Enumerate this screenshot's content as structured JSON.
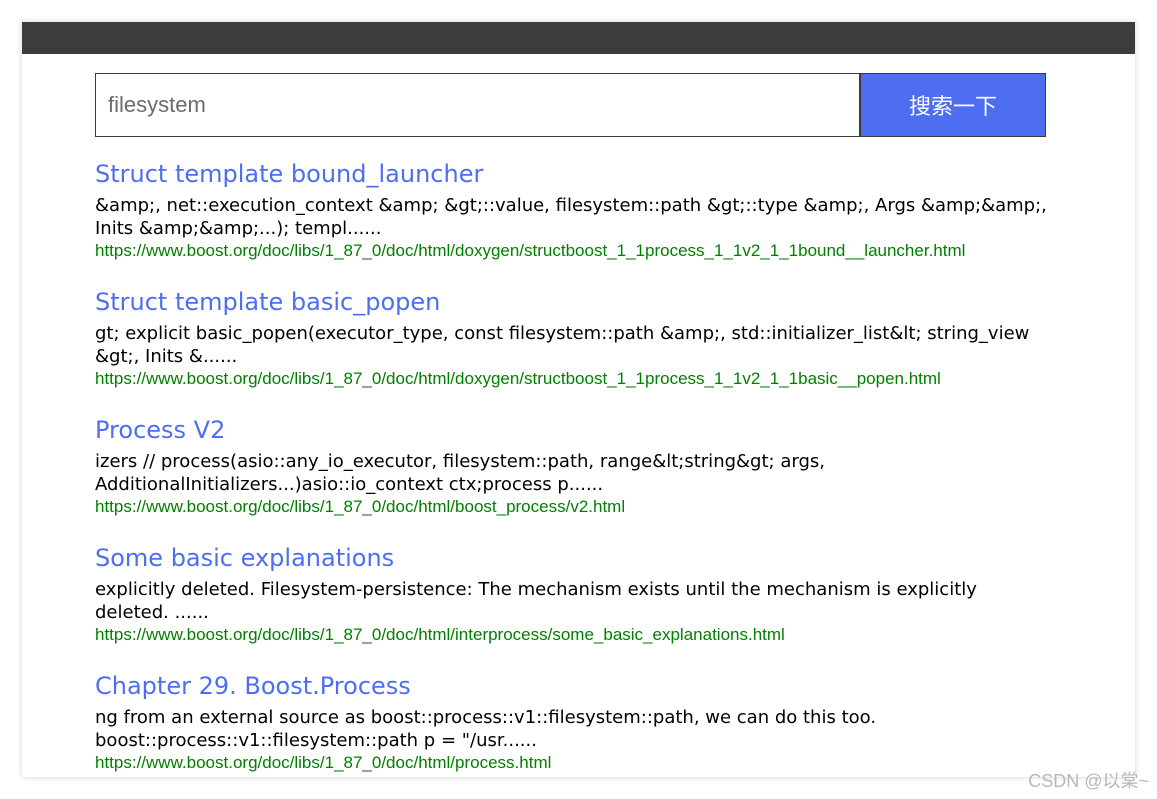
{
  "search": {
    "value": "filesystem",
    "button_label": "搜索一下"
  },
  "results": [
    {
      "title": "Struct template bound_launcher",
      "desc": "&amp;, net::execution_context &amp; &gt;::value, filesystem::path &gt;::type &amp;, Args &amp;&amp;, Inits &amp;&amp;...); templ......",
      "url": "https://www.boost.org/doc/libs/1_87_0/doc/html/doxygen/structboost_1_1process_1_1v2_1_1bound__launcher.html"
    },
    {
      "title": "Struct template basic_popen",
      "desc": "gt; explicit basic_popen(executor_type, const filesystem::path &amp;, std::initializer_list&lt; string_view &gt;, Inits &......",
      "url": "https://www.boost.org/doc/libs/1_87_0/doc/html/doxygen/structboost_1_1process_1_1v2_1_1basic__popen.html"
    },
    {
      "title": "Process V2",
      "desc": "izers // process(asio::any_io_executor, filesystem::path, range&lt;string&gt; args, AdditionalInitializers...)asio::io_context ctx;process p......",
      "url": "https://www.boost.org/doc/libs/1_87_0/doc/html/boost_process/v2.html"
    },
    {
      "title": "Some basic explanations",
      "desc": "explicitly deleted. Filesystem-persistence: The mechanism exists until the mechanism is explicitly deleted. ......",
      "url": "https://www.boost.org/doc/libs/1_87_0/doc/html/interprocess/some_basic_explanations.html"
    },
    {
      "title": "Chapter 29. Boost.Process",
      "desc": "ng from an external source as boost::process::v1::filesystem::path, we can do this too. boost::process::v1::filesystem::path p = \"/usr......",
      "url": "https://www.boost.org/doc/libs/1_87_0/doc/html/process.html"
    }
  ],
  "watermark": "CSDN @以棠~"
}
